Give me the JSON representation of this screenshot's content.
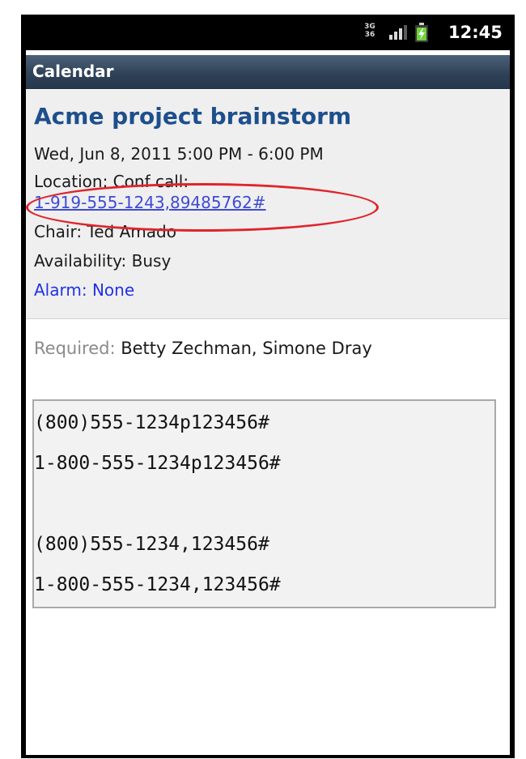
{
  "status_bar": {
    "network_top": "3G",
    "network_bottom": "36",
    "time": "12:45",
    "network_icon": "network-type-icon",
    "signal_icon": "signal-strength-icon",
    "battery_icon": "battery-charging-icon"
  },
  "title_bar": {
    "title": "Calendar"
  },
  "event": {
    "title": "Acme project brainstorm",
    "datetime": "Wed, Jun 8, 2011 5:00 PM - 6:00 PM",
    "location_label": "Location: Conf call:",
    "location_phone": "1-919-555-1243,89485762#",
    "chair": "Chair: Ted Amado",
    "availability": "Availability: Busy",
    "alarm": "Alarm: None"
  },
  "attendees": {
    "label": "Required:",
    "names": "Betty Zechman, Simone Dray"
  },
  "code_sample": {
    "lines": [
      "(800)555-1234p123456#",
      "1-800-555-1234p123456#",
      "(800)555-1234,123456#",
      "1-800-555-1234,123456#"
    ]
  },
  "colors": {
    "title_text": "#1e4f8c",
    "link": "#3f4bd6",
    "alarm": "#2131e8",
    "highlight_ring": "#e0242b",
    "title_bar": "#2f4258"
  }
}
